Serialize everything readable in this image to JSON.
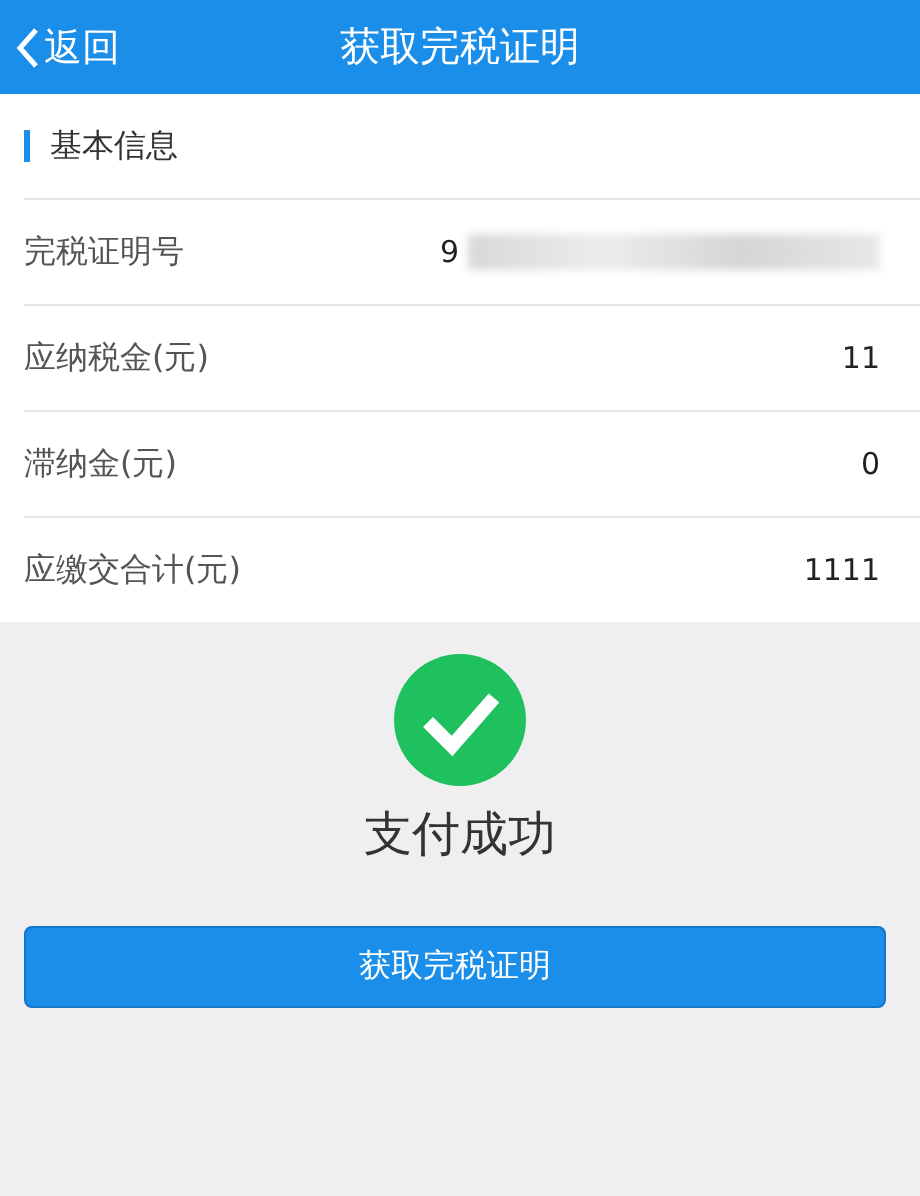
{
  "header": {
    "back": "返回",
    "title": "获取完税证明"
  },
  "section": {
    "title": "基本信息",
    "rows": [
      {
        "label": "完税证明号",
        "value": "9",
        "redacted": true
      },
      {
        "label": "应纳税金(元)",
        "value": "11",
        "redacted": false
      },
      {
        "label": "滞纳金(元)",
        "value": "0",
        "redacted": false
      },
      {
        "label": "应缴交合计(元)",
        "value": "1111",
        "redacted": false
      }
    ]
  },
  "result": {
    "message": "支付成功"
  },
  "button": "获取完税证明"
}
